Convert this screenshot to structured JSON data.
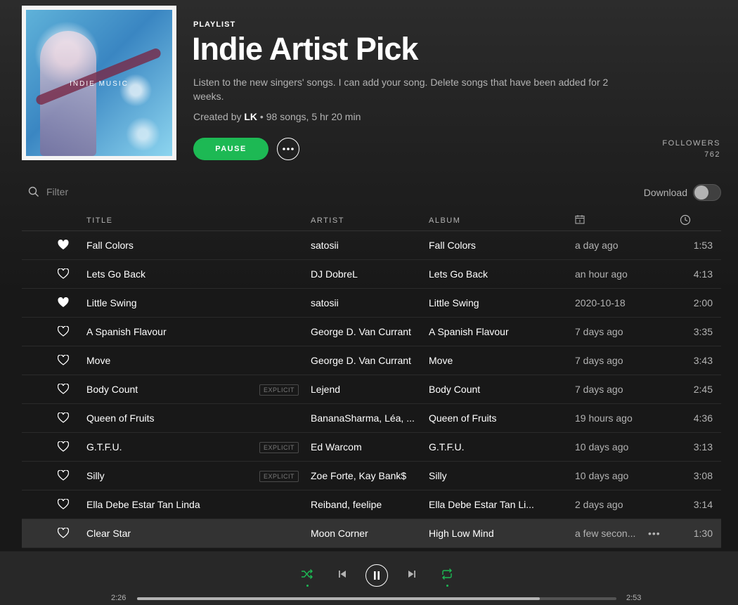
{
  "playlist": {
    "cover_text": "INDIE MUSIC",
    "type_label": "PLAYLIST",
    "title": "Indie Artist Pick",
    "description": "Listen to the new singers' songs. I can add your song. Delete songs that have been added for 2 weeks.",
    "created_by_prefix": "Created by",
    "owner": "LK",
    "stats": " • 98 songs, 5 hr 20 min",
    "pause_label": "PAUSE",
    "more_icon": "more-horizontal-icon",
    "followers_label": "FOLLOWERS",
    "followers_count": "762"
  },
  "toolbar": {
    "filter_placeholder": "Filter",
    "download_label": "Download",
    "download_enabled": false
  },
  "table": {
    "columns": {
      "title": "TITLE",
      "artist": "ARTIST",
      "album": "ALBUM"
    },
    "date_icon": "calendar-icon",
    "duration_icon": "clock-icon",
    "rows": [
      {
        "liked": true,
        "title": "Fall Colors",
        "explicit": false,
        "artist": "satosii",
        "album": "Fall Colors",
        "added": "a day ago",
        "duration": "1:53"
      },
      {
        "liked": false,
        "title": "Lets Go Back",
        "explicit": false,
        "artist": "DJ DobreL",
        "album": "Lets Go Back",
        "added": "an hour ago",
        "duration": "4:13"
      },
      {
        "liked": true,
        "title": "Little Swing",
        "explicit": false,
        "artist": "satosii",
        "album": "Little Swing",
        "added": "2020-10-18",
        "duration": "2:00"
      },
      {
        "liked": false,
        "title": "A Spanish Flavour",
        "explicit": false,
        "artist": "George D. Van Currant",
        "album": "A Spanish Flavour",
        "added": "7 days ago",
        "duration": "3:35"
      },
      {
        "liked": false,
        "title": "Move",
        "explicit": false,
        "artist": "George D. Van Currant",
        "album": "Move",
        "added": "7 days ago",
        "duration": "3:43"
      },
      {
        "liked": false,
        "title": "Body Count",
        "explicit": true,
        "artist": "Lejend",
        "album": "Body Count",
        "added": "7 days ago",
        "duration": "2:45"
      },
      {
        "liked": false,
        "title": "Queen of Fruits",
        "explicit": false,
        "artist": "BananaSharma, Léa, ...",
        "album": "Queen of Fruits",
        "added": "19 hours ago",
        "duration": "4:36"
      },
      {
        "liked": false,
        "title": "G.T.F.U.",
        "explicit": true,
        "artist": "Ed Warcom",
        "album": "G.T.F.U.",
        "added": "10 days ago",
        "duration": "3:13"
      },
      {
        "liked": false,
        "title": "Silly",
        "explicit": true,
        "artist": "Zoe Forte, Kay Bank$",
        "album": "Silly",
        "added": "10 days ago",
        "duration": "3:08"
      },
      {
        "liked": false,
        "title": "Ella Debe Estar Tan Linda",
        "explicit": false,
        "artist": "Reiband, feelipe",
        "album": "Ella Debe Estar Tan Li...",
        "added": "2 days ago",
        "duration": "3:14"
      },
      {
        "liked": false,
        "title": "Clear Star",
        "explicit": false,
        "artist": "Moon Corner",
        "album": "High Low Mind",
        "added": "a few secon...",
        "duration": "1:30",
        "active": true
      }
    ],
    "explicit_label": "EXPLICIT"
  },
  "player": {
    "elapsed": "2:26",
    "total": "2:53",
    "progress": 0.84,
    "shuffle_on": true,
    "repeat_on": true,
    "accent": "#1db954"
  }
}
